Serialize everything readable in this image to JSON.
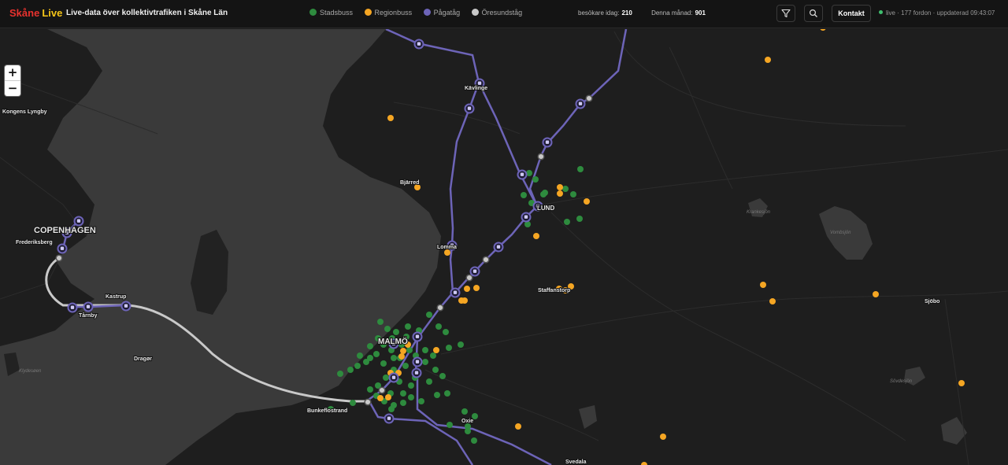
{
  "header": {
    "brand_part1": "Skåne",
    "brand_part2": "Live",
    "tagline": "Live-data över kollektivtrafiken i Skåne Län",
    "legend": [
      {
        "label": "Stadsbuss",
        "color": "#2e8b3e"
      },
      {
        "label": "Regionbuss",
        "color": "#f5a623"
      },
      {
        "label": "Pågatåg",
        "color": "#6d64b8"
      },
      {
        "label": "Öresundståg",
        "color": "#c9c9c9"
      }
    ],
    "visitors_today_label": "besökare idag:",
    "visitors_today_value": "210",
    "month_label": "Denna månad:",
    "month_value": "901",
    "filter_icon": "filter-icon",
    "search_icon": "search-icon",
    "contact_label": "Kontakt",
    "live_label": "live",
    "vehicle_count": "177 fordon",
    "updated_text": "uppdaterad 09:43:07"
  },
  "map": {
    "zoom_in": "+",
    "zoom_out": "−",
    "place_labels": [
      "Kongens Lyngby",
      "COPENHAGEN",
      "Frederiksberg",
      "Kastrup",
      "Tårnby",
      "Dragør",
      "Klydesøen",
      "Kävlinge",
      "Bjärred",
      "LUND",
      "Lomma",
      "Staffanstorp",
      "MALMÖ",
      "Bunkeflostrand",
      "Oxie",
      "Svedala",
      "Sjöbo",
      "Krankesjön",
      "Vombsjön",
      "Sövdesjön"
    ],
    "colors": {
      "stadsbuss": "#2e8b3e",
      "regionbuss": "#f5a623",
      "pagatag": "#6d64b8",
      "oresundstag": "#c9c9c9",
      "water": "#3a3a3a",
      "land": "#1e1e1e"
    },
    "icons": [
      "train-icon",
      "bus-dot"
    ]
  }
}
